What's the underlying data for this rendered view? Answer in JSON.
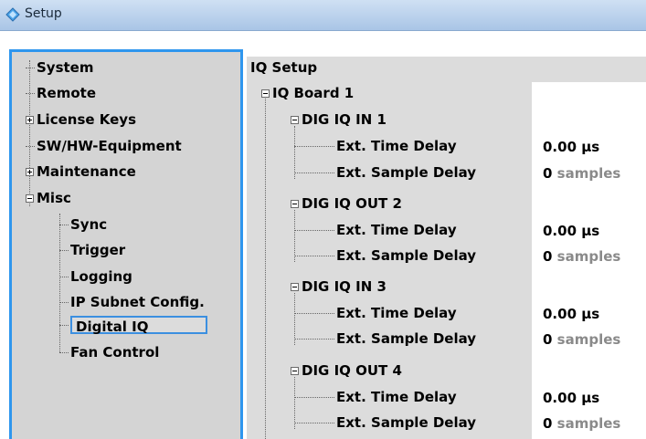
{
  "window": {
    "title": "Setup"
  },
  "sidebar": {
    "items": [
      {
        "label": "System"
      },
      {
        "label": "Remote"
      },
      {
        "label": "License Keys"
      },
      {
        "label": "SW/HW-Equipment"
      },
      {
        "label": "Maintenance"
      },
      {
        "label": "Misc"
      },
      {
        "label": "Sync"
      },
      {
        "label": "Trigger"
      },
      {
        "label": "Logging"
      },
      {
        "label": "IP Subnet Config."
      },
      {
        "label": "Digital IQ"
      },
      {
        "label": "Fan Control"
      }
    ],
    "selected": "Digital IQ"
  },
  "main": {
    "header": "IQ Setup",
    "board": "IQ Board 1",
    "groups": [
      {
        "label": "DIG IQ IN 1",
        "time_delay_label": "Ext. Time Delay",
        "time_delay_value": "0.00 µs",
        "sample_delay_label": "Ext. Sample Delay",
        "sample_delay_value": "0",
        "sample_delay_unit": "samples"
      },
      {
        "label": "DIG IQ OUT 2",
        "time_delay_label": "Ext. Time Delay",
        "time_delay_value": "0.00 µs",
        "sample_delay_label": "Ext. Sample Delay",
        "sample_delay_value": "0",
        "sample_delay_unit": "samples"
      },
      {
        "label": "DIG IQ IN 3",
        "time_delay_label": "Ext. Time Delay",
        "time_delay_value": "0.00 µs",
        "sample_delay_label": "Ext. Sample Delay",
        "sample_delay_value": "0",
        "sample_delay_unit": "samples"
      },
      {
        "label": "DIG IQ OUT 4",
        "time_delay_label": "Ext. Time Delay",
        "time_delay_value": "0.00 µs",
        "sample_delay_label": "Ext. Sample Delay",
        "sample_delay_value": "0",
        "sample_delay_unit": "samples"
      }
    ]
  },
  "colors": {
    "accent": "#2e96ee",
    "panel": "#d4d4d4",
    "unit_gray": "#8a8a8a"
  }
}
